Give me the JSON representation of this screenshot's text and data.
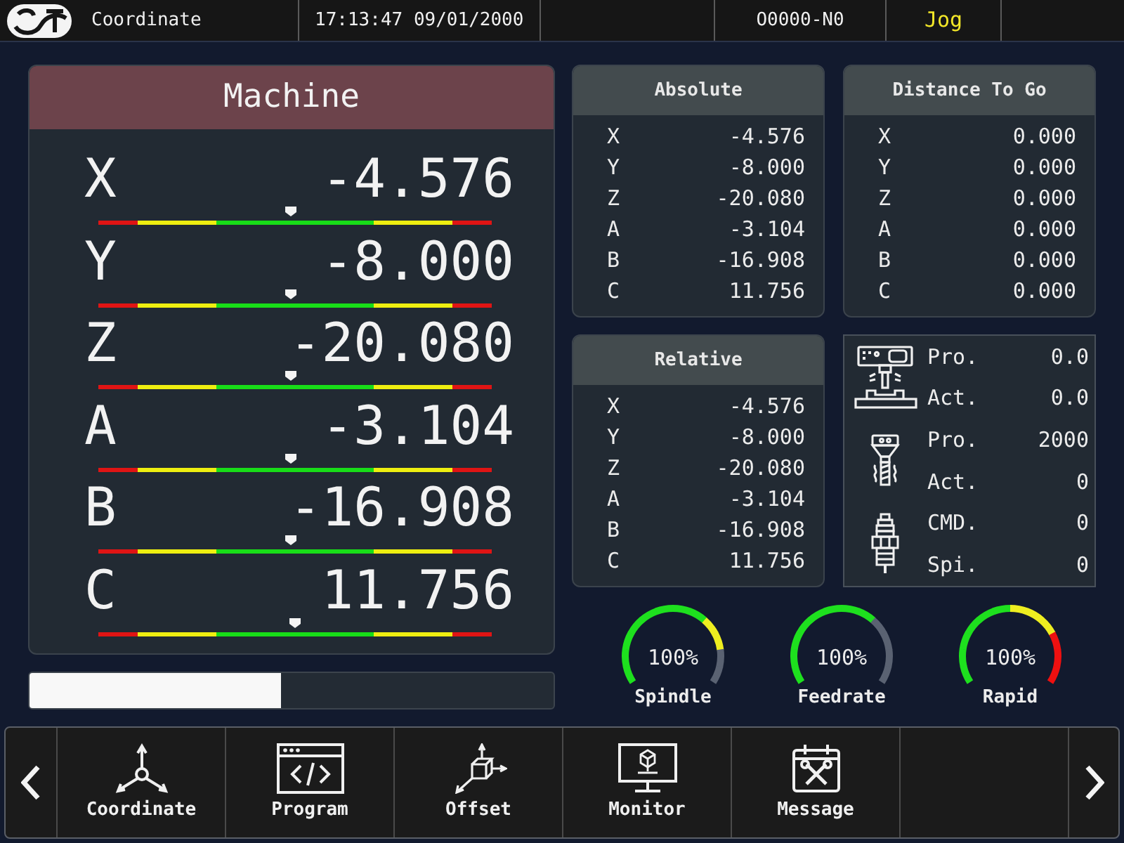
{
  "top_bar": {
    "screen": "Coordinate",
    "datetime": "17:13:47 09/01/2000",
    "program": "O0000-N0",
    "mode": "Jog"
  },
  "machine": {
    "title": "Machine",
    "axes": [
      {
        "axis": "X",
        "value": "-4.576",
        "level": 0.49
      },
      {
        "axis": "Y",
        "value": "-8.000",
        "level": 0.49
      },
      {
        "axis": "Z",
        "value": "-20.080",
        "level": 0.49
      },
      {
        "axis": "A",
        "value": "-3.104",
        "level": 0.49
      },
      {
        "axis": "B",
        "value": "-16.908",
        "level": 0.49
      },
      {
        "axis": "C",
        "value": "11.756",
        "level": 0.5
      }
    ]
  },
  "progress": {
    "level": 0.48
  },
  "absolute": {
    "title": "Absolute",
    "axes": [
      {
        "axis": "X",
        "value": "-4.576"
      },
      {
        "axis": "Y",
        "value": "-8.000"
      },
      {
        "axis": "Z",
        "value": "-20.080"
      },
      {
        "axis": "A",
        "value": "-3.104"
      },
      {
        "axis": "B",
        "value": "-16.908"
      },
      {
        "axis": "C",
        "value": "11.756"
      }
    ]
  },
  "distance_to_go": {
    "title": "Distance To Go",
    "axes": [
      {
        "axis": "X",
        "value": "0.000"
      },
      {
        "axis": "Y",
        "value": "0.000"
      },
      {
        "axis": "Z",
        "value": "0.000"
      },
      {
        "axis": "A",
        "value": "0.000"
      },
      {
        "axis": "B",
        "value": "0.000"
      },
      {
        "axis": "C",
        "value": "0.000"
      }
    ]
  },
  "relative": {
    "title": "Relative",
    "axes": [
      {
        "axis": "X",
        "value": "-4.576"
      },
      {
        "axis": "Y",
        "value": "-8.000"
      },
      {
        "axis": "Z",
        "value": "-20.080"
      },
      {
        "axis": "A",
        "value": "-3.104"
      },
      {
        "axis": "B",
        "value": "-16.908"
      },
      {
        "axis": "C",
        "value": "11.756"
      }
    ]
  },
  "status_panel": {
    "groups": [
      {
        "kind": "machine",
        "rows": [
          {
            "label": "Pro.",
            "value": "0.0"
          },
          {
            "label": "Act.",
            "value": "0.0"
          }
        ]
      },
      {
        "kind": "spindle",
        "rows": [
          {
            "label": "Pro.",
            "value": "2000"
          },
          {
            "label": "Act.",
            "value": "0"
          }
        ]
      },
      {
        "kind": "plug",
        "rows": [
          {
            "label": "CMD.",
            "value": "0"
          },
          {
            "label": "Spi.",
            "value": "0"
          }
        ]
      }
    ]
  },
  "gauges": [
    {
      "label": "Spindle",
      "reading": "100%",
      "arc": [
        {
          "color": "#1ee01e"
        },
        {
          "color": "#1ee01e"
        },
        {
          "color": "#1ee01e"
        },
        {
          "color": "#1ee01e"
        },
        {
          "color": "#1ee01e"
        },
        {
          "color": "#1ee01e"
        },
        {
          "color": "#1ee01e"
        },
        {
          "color": "#1ee01e"
        },
        {
          "color": "#eeee20"
        },
        {
          "color": "#eeee20"
        },
        {
          "color": "#5a6272"
        },
        {
          "color": "#5a6272"
        }
      ]
    },
    {
      "label": "Feedrate",
      "reading": "100%",
      "arc": [
        {
          "color": "#1ee01e"
        },
        {
          "color": "#1ee01e"
        },
        {
          "color": "#1ee01e"
        },
        {
          "color": "#1ee01e"
        },
        {
          "color": "#1ee01e"
        },
        {
          "color": "#1ee01e"
        },
        {
          "color": "#1ee01e"
        },
        {
          "color": "#1ee01e"
        },
        {
          "color": "#5a6272"
        },
        {
          "color": "#5a6272"
        },
        {
          "color": "#5a6272"
        },
        {
          "color": "#5a6272"
        }
      ]
    },
    {
      "label": "Rapid",
      "reading": "100%",
      "arc": [
        {
          "color": "#1ee01e"
        },
        {
          "color": "#1ee01e"
        },
        {
          "color": "#1ee01e"
        },
        {
          "color": "#1ee01e"
        },
        {
          "color": "#1ee01e"
        },
        {
          "color": "#1ee01e"
        },
        {
          "color": "#eeee20"
        },
        {
          "color": "#eeee20"
        },
        {
          "color": "#eeee20"
        },
        {
          "color": "#ee1010"
        },
        {
          "color": "#ee1010"
        },
        {
          "color": "#ee1010"
        }
      ]
    }
  ],
  "toolbar": {
    "items": [
      {
        "label": "Coordinate",
        "kind": "axes"
      },
      {
        "label": "Program",
        "kind": "code"
      },
      {
        "label": "Offset",
        "kind": "offset"
      },
      {
        "label": "Monitor",
        "kind": "monitor"
      },
      {
        "label": "Message",
        "kind": "calendar"
      }
    ]
  }
}
